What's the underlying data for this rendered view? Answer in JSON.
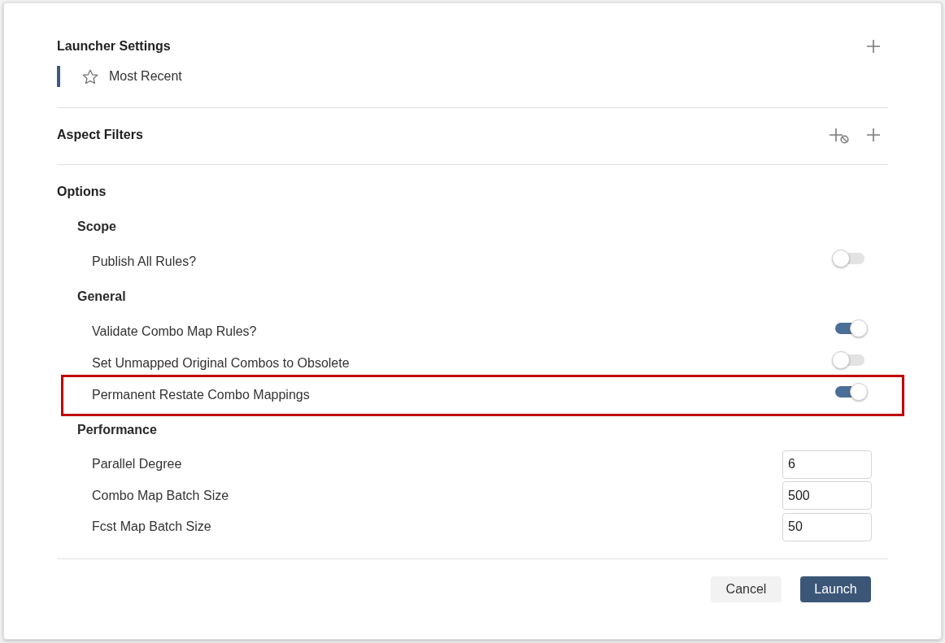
{
  "launcher_settings": {
    "title": "Launcher Settings",
    "items": [
      {
        "label": "Most Recent",
        "selected": true
      }
    ]
  },
  "aspect_filters": {
    "title": "Aspect Filters"
  },
  "options": {
    "title": "Options",
    "groups": [
      {
        "title": "Scope",
        "options": [
          {
            "kind": "toggle",
            "label": "Publish All Rules?",
            "on": false,
            "highlighted": false
          }
        ]
      },
      {
        "title": "General",
        "options": [
          {
            "kind": "toggle",
            "label": "Validate Combo Map Rules?",
            "on": true,
            "highlighted": false
          },
          {
            "kind": "toggle",
            "label": "Set Unmapped Original Combos to Obsolete",
            "on": false,
            "highlighted": false
          },
          {
            "kind": "toggle",
            "label": "Permanent Restate Combo Mappings",
            "on": true,
            "highlighted": true
          }
        ]
      },
      {
        "title": "Performance",
        "options": [
          {
            "kind": "number",
            "label": "Parallel Degree",
            "value": "6",
            "highlighted": false
          },
          {
            "kind": "number",
            "label": "Combo Map Batch Size",
            "value": "500",
            "highlighted": false
          },
          {
            "kind": "number",
            "label": "Fcst Map Batch Size",
            "value": "50",
            "highlighted": false
          }
        ]
      }
    ]
  },
  "buttons": [
    {
      "kind": "secondary",
      "label": "Cancel"
    },
    {
      "kind": "primary",
      "label": "Launch"
    }
  ]
}
